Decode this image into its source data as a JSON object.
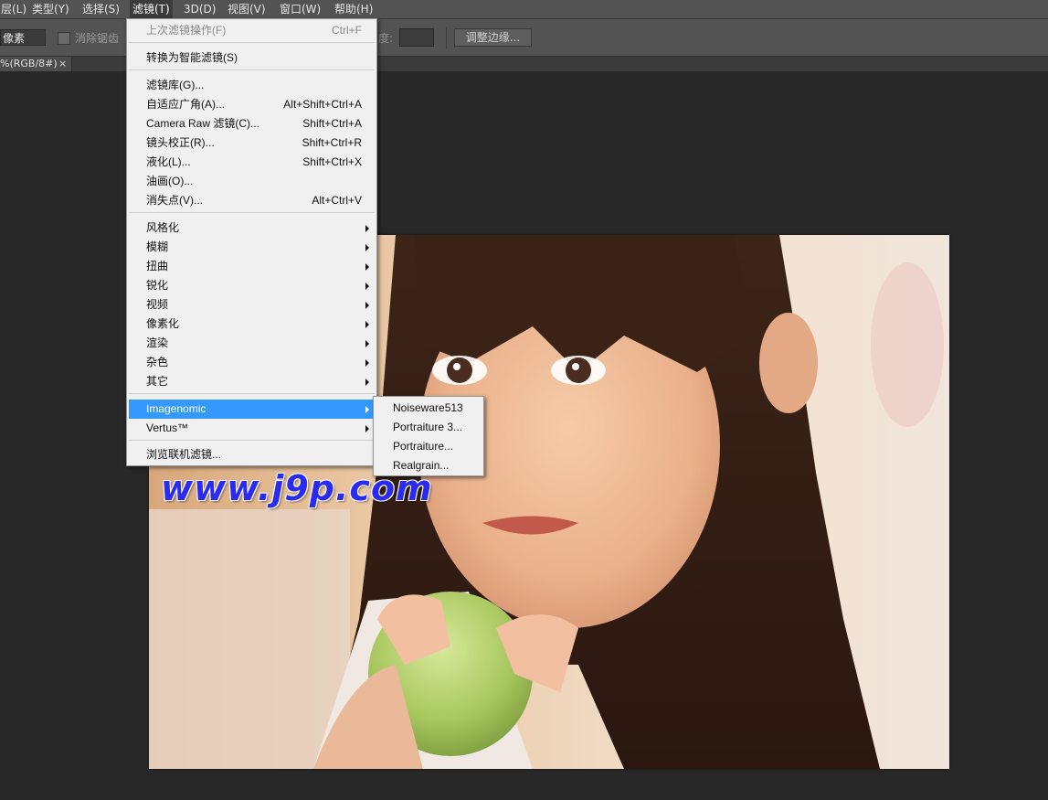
{
  "menubar": {
    "items": [
      "层(L)",
      "类型(Y)",
      "选择(S)",
      "滤镜(T)",
      "3D(D)",
      "视图(V)",
      "窗口(W)",
      "帮助(H)"
    ],
    "active": "滤镜(T)"
  },
  "options": {
    "feather_value": "像素",
    "antialias_label": "消除锯齿",
    "antialias_checked": false,
    "width_label": "度:",
    "width_value": "",
    "refine_edge_label": "调整边缘..."
  },
  "document_tab": {
    "title": "%(RGB/8#)",
    "close_icon": "close-icon",
    "close_glyph": "×"
  },
  "canvas": {
    "watermark": "www.j9p.com"
  },
  "filter_menu": {
    "last_filter": {
      "label": "上次滤镜操作(F)",
      "shortcut": "Ctrl+F",
      "enabled": false
    },
    "convert_smart": {
      "label": "转换为智能滤镜(S)"
    },
    "gallery": {
      "label": "滤镜库(G)..."
    },
    "adaptive_wide": {
      "label": "自适应广角(A)...",
      "shortcut": "Alt+Shift+Ctrl+A"
    },
    "camera_raw": {
      "label": "Camera Raw 滤镜(C)...",
      "shortcut": "Shift+Ctrl+A"
    },
    "lens_correction": {
      "label": "镜头校正(R)...",
      "shortcut": "Shift+Ctrl+R"
    },
    "liquify": {
      "label": "液化(L)...",
      "shortcut": "Shift+Ctrl+X"
    },
    "oil_paint": {
      "label": "油画(O)..."
    },
    "vanishing_point": {
      "label": "消失点(V)...",
      "shortcut": "Alt+Ctrl+V"
    },
    "stylize": {
      "label": "风格化"
    },
    "blur": {
      "label": "模糊"
    },
    "distort": {
      "label": "扭曲"
    },
    "sharpen": {
      "label": "锐化"
    },
    "video": {
      "label": "视频"
    },
    "pixelate": {
      "label": "像素化"
    },
    "render": {
      "label": "渲染"
    },
    "noise": {
      "label": "杂色"
    },
    "other": {
      "label": "其它"
    },
    "imagenomic": {
      "label": "Imagenomic",
      "highlighted": true
    },
    "vertus": {
      "label": "Vertus™"
    },
    "browse_online": {
      "label": "浏览联机滤镜..."
    }
  },
  "imagenomic_submenu": {
    "items": [
      "Noiseware513",
      "Portraiture 3...",
      "Portraiture...",
      "Realgrain..."
    ]
  },
  "colors": {
    "menu_highlight": "#3399ff",
    "ui_background": "#535353",
    "canvas_background": "#282828",
    "watermark": "#2b2bf0"
  }
}
